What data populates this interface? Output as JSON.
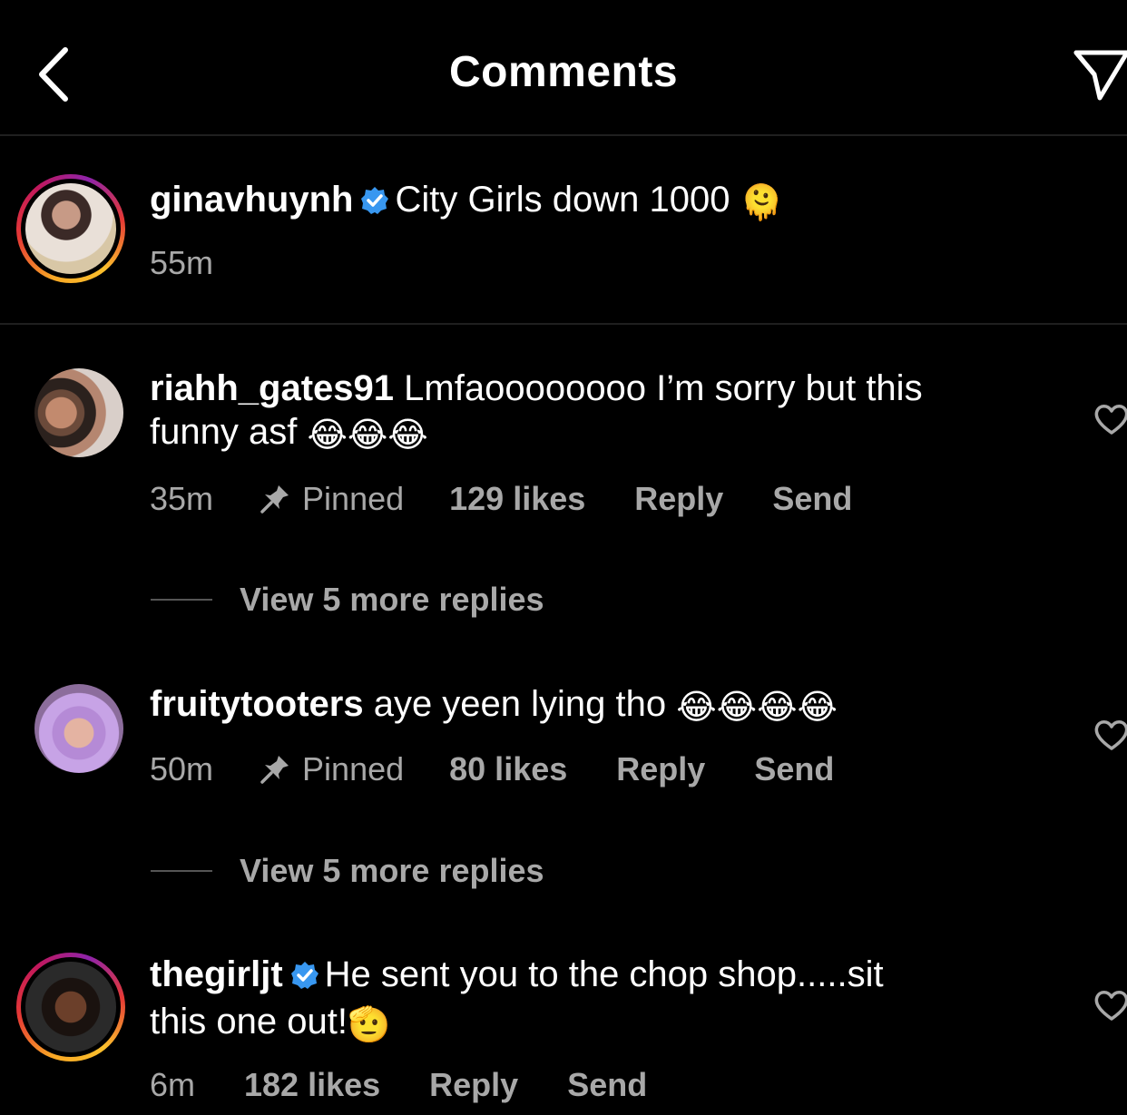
{
  "header": {
    "title": "Comments"
  },
  "caption": {
    "username": "ginavhuynh",
    "text": "City Girls down 1000",
    "emoji": "🫠",
    "time": "55m"
  },
  "comments": [
    {
      "username": "riahh_gates91",
      "text_line1": "Lmfaoooooooo I’m sorry but this",
      "text_line2": "funny asf",
      "emoji": "😂😂😂",
      "time": "35m",
      "pinned_label": "Pinned",
      "likes": "129 likes",
      "reply_label": "Reply",
      "send_label": "Send",
      "view_replies": "View 5 more replies"
    },
    {
      "username": "fruitytooters",
      "text_line1": "aye yeen lying tho",
      "emoji": "😂😂😂😂",
      "time": "50m",
      "pinned_label": "Pinned",
      "likes": "80 likes",
      "reply_label": "Reply",
      "send_label": "Send",
      "view_replies": "View 5 more replies"
    },
    {
      "username": "thegirljt",
      "text_line1": "He sent you to the chop shop.....sit",
      "text_line2": "this one out!",
      "emoji": "🫡",
      "time": "6m",
      "likes": "182 likes",
      "reply_label": "Reply",
      "send_label": "Send"
    }
  ],
  "colors": {
    "background": "#000000",
    "secondary_text": "#a8a8a8",
    "verified": "#3897f0"
  }
}
